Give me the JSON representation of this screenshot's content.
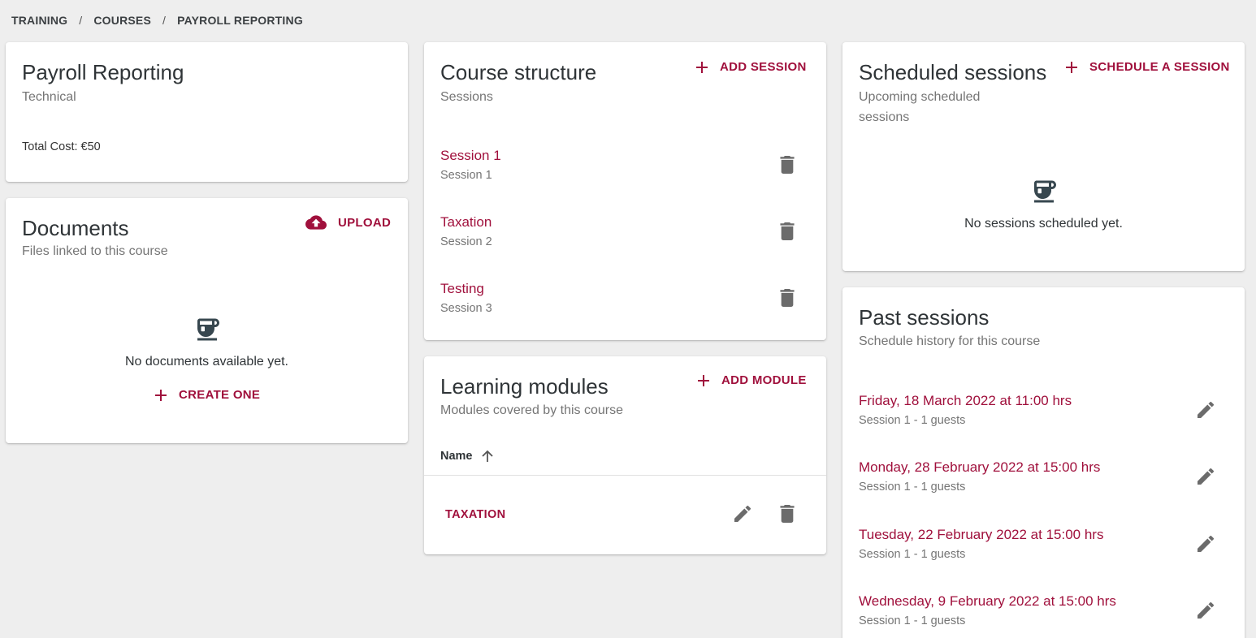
{
  "breadcrumb": [
    "TRAINING",
    "COURSES",
    "PAYROLL REPORTING"
  ],
  "course": {
    "title": "Payroll Reporting",
    "category": "Technical",
    "total_cost": "Total Cost: €50"
  },
  "documents": {
    "title": "Documents",
    "subtitle": "Files linked to this course",
    "upload_label": "UPLOAD",
    "empty_text": "No documents available yet.",
    "create_label": "CREATE ONE"
  },
  "structure": {
    "title": "Course structure",
    "subtitle": "Sessions",
    "add_label": "ADD SESSION",
    "sessions": [
      {
        "name": "Session 1",
        "sub": "Session 1"
      },
      {
        "name": "Taxation",
        "sub": "Session 2"
      },
      {
        "name": "Testing",
        "sub": "Session 3"
      }
    ]
  },
  "modules": {
    "title": "Learning modules",
    "subtitle": "Modules covered by this course",
    "add_label": "ADD MODULE",
    "column_name": "Name",
    "rows": [
      "TAXATION"
    ]
  },
  "scheduled": {
    "title": "Scheduled sessions",
    "subtitle": "Upcoming scheduled sessions",
    "add_label": "SCHEDULE A SESSION",
    "empty_text": "No sessions scheduled yet."
  },
  "past": {
    "title": "Past sessions",
    "subtitle": "Schedule history for this course",
    "items": [
      {
        "date": "Friday, 18 March 2022 at 11:00 hrs",
        "sub": "Session 1 - 1 guests"
      },
      {
        "date": "Monday, 28 February 2022 at 15:00 hrs",
        "sub": "Session 1 - 1 guests"
      },
      {
        "date": "Tuesday, 22 February 2022 at 15:00 hrs",
        "sub": "Session 1 - 1 guests"
      },
      {
        "date": "Wednesday, 9 February 2022 at 15:00 hrs",
        "sub": "Session 1 - 1 guests"
      }
    ]
  },
  "colors": {
    "accent": "#a0103c",
    "background": "#eeeeee",
    "icon_gray": "#6b6b6b",
    "empty_icon": "#37474f"
  },
  "icons": {
    "add": "plus-icon",
    "upload": "cloud-upload-icon",
    "empty": "coffee-cup-icon",
    "delete": "trash-icon",
    "edit": "pencil-icon",
    "sort": "arrow-up-icon"
  }
}
